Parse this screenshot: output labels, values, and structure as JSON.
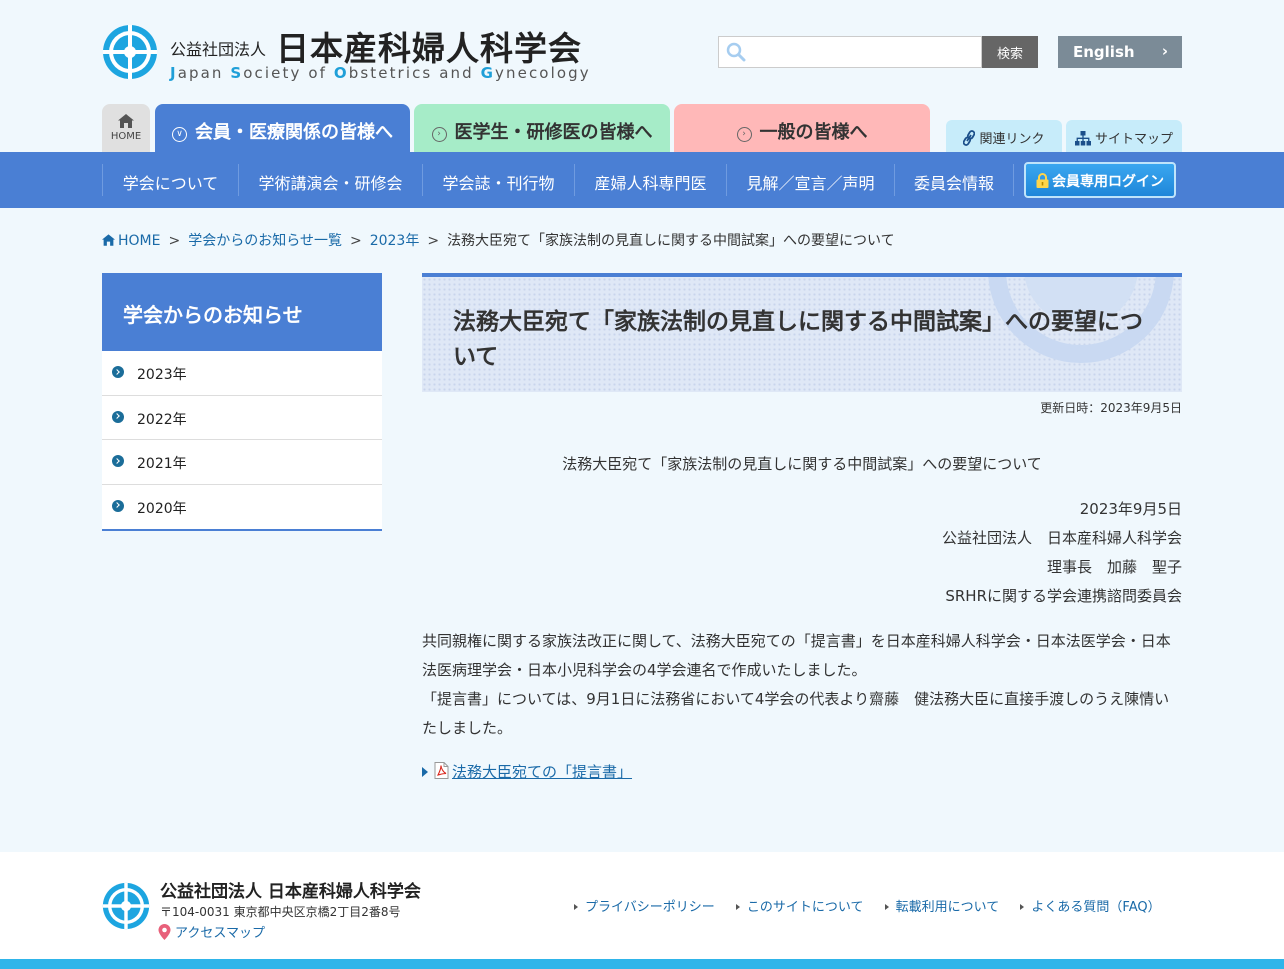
{
  "header": {
    "org_prefix": "公益社団法人",
    "org_name": "日本産科婦人科学会",
    "org_name_en": {
      "j": "J",
      "r1": "apan ",
      "s": "S",
      "r2": "ociety of ",
      "o": "O",
      "r3": "bstetrics and ",
      "g": "G",
      "r4": "ynecology"
    },
    "search_placeholder": "",
    "search_button": "検索",
    "english_label": "English"
  },
  "audience_tabs": {
    "home": "HOME",
    "members": "会員・医療関係の皆様へ",
    "students": "医学生・研修医の皆様へ",
    "public": "一般の皆様へ",
    "related_links": "関連リンク",
    "sitemap": "サイトマップ"
  },
  "gnav": {
    "items": [
      "学会について",
      "学術講演会・研修会",
      "学会誌・刊行物",
      "産婦人科専門医",
      "見解／宣言／声明",
      "委員会情報"
    ],
    "login": "会員専用ログイン"
  },
  "breadcrumb": {
    "home": "HOME",
    "news_list": "学会からのお知らせ一覧",
    "year": "2023年",
    "current": "法務大臣宛て「家族法制の見直しに関する中間試案」への要望について",
    "separator": ">"
  },
  "sidebar": {
    "heading": "学会からのお知らせ",
    "items": [
      "2023年",
      "2022年",
      "2021年",
      "2020年"
    ]
  },
  "main": {
    "title": "法務大臣宛て「家族法制の見直しに関する中間試案」への要望について",
    "updated": "更新日時：2023年9月5日",
    "doc_heading": "法務大臣宛て「家族法制の見直しに関する中間試案」への要望について",
    "date": "2023年9月5日",
    "org": "公益社団法人　日本産科婦人科学会",
    "chair": "理事長　加藤　聖子",
    "committee": "SRHRに関する学会連携諮問委員会",
    "paragraph1": "共同親権に関する家族法改正に関して、法務大臣宛ての「提言書」を日本産科婦人科学会・日本法医学会・日本法医病理学会・日本小児科学会の4学会連名で作成いたしました。",
    "paragraph2": "「提言書」については、9月1日に法務省において4学会の代表より齋藤　健法務大臣に直接手渡しのうえ陳情いたしました。",
    "pdf_link": "法務大臣宛ての「提言書」"
  },
  "footer": {
    "org": "公益社団法人 日本産科婦人科学会",
    "address": "〒104-0031 東京都中央区京橋2丁目2番8号",
    "access_map": "アクセスマップ",
    "links": [
      "プライバシーポリシー",
      "このサイトについて",
      "転載利用について",
      "よくある質問（FAQ）"
    ]
  },
  "colors": {
    "primary_blue": "#4a7fd4",
    "students_green": "#a6ecc8",
    "public_pink": "#ffb8b8",
    "link_blue": "#1a6aa8",
    "footer_bar": "#2fb5ea",
    "background": "#f0f8fd"
  }
}
